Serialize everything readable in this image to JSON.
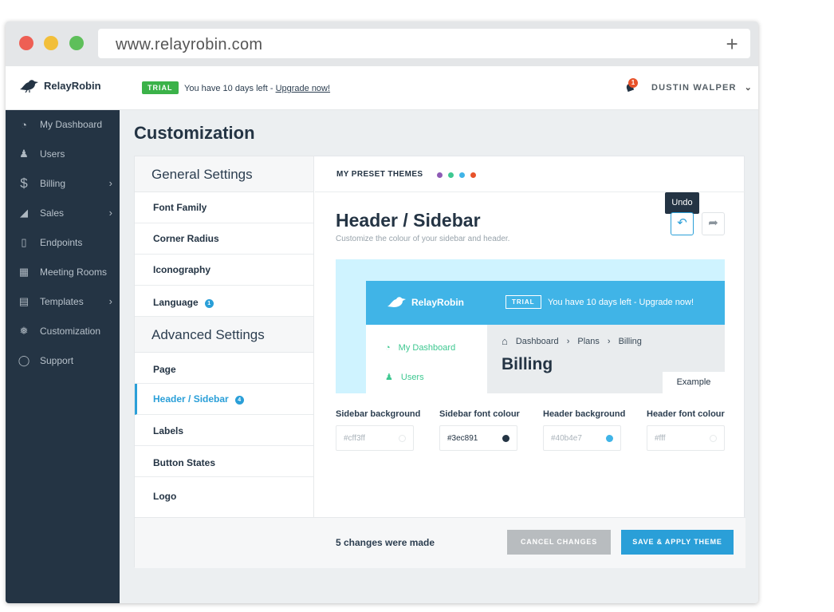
{
  "browser": {
    "url": "www.relayrobin.com"
  },
  "topbar": {
    "logo_text": "RelayRobin",
    "trial_badge": "TRIAL",
    "trial_message": "You have 10 days left - ",
    "upgrade_link": "Upgrade now!",
    "notification_count": "1",
    "user_name": "DUSTIN WALPER"
  },
  "sidebar": {
    "items": [
      {
        "label": "My Dashboard",
        "icon": "gauge-icon"
      },
      {
        "label": "Users",
        "icon": "users-icon"
      },
      {
        "label": "Billing",
        "icon": "dollar-icon",
        "has_submenu": true
      },
      {
        "label": "Sales",
        "icon": "chart-icon",
        "has_submenu": true
      },
      {
        "label": "Endpoints",
        "icon": "phone-icon"
      },
      {
        "label": "Meeting Rooms",
        "icon": "chat-icon"
      },
      {
        "label": "Templates",
        "icon": "template-icon",
        "has_submenu": true
      },
      {
        "label": "Customization",
        "icon": "drops-icon"
      },
      {
        "label": "Support",
        "icon": "lifebuoy-icon"
      }
    ]
  },
  "page": {
    "title": "Customization"
  },
  "left": {
    "general_heading": "General Settings",
    "general_items": [
      "Font Family",
      "Corner Radius",
      "Iconography",
      "Language"
    ],
    "language_count": "1",
    "advanced_heading": "Advanced Settings",
    "advanced_items": [
      "Page",
      "Header / Sidebar",
      "Labels",
      "Button States",
      "Logo"
    ],
    "header_sidebar_count": "4"
  },
  "presets": {
    "label": "MY PRESET THEMES",
    "colors": [
      "#8e5bb5",
      "#3ec891",
      "#40b4e7",
      "#e7522a"
    ]
  },
  "section": {
    "title": "Header / Sidebar",
    "subtitle": "Customize the colour of your sidebar and header.",
    "undo_tooltip": "Undo"
  },
  "preview": {
    "logo_text": "RelayRobin",
    "trial_badge": "TRIAL",
    "trial_message": "You have 10 days left - Upgrade now!",
    "nav_dashboard": "My Dashboard",
    "nav_users": "Users",
    "crumbs": [
      "Dashboard",
      "Plans",
      "Billing"
    ],
    "title": "Billing",
    "example_button": "Example"
  },
  "fields": [
    {
      "label": "Sidebar background",
      "value": "#cff3ff",
      "swatch": "#ffffff"
    },
    {
      "label": "Sidebar font colour",
      "value": "#3ec891",
      "swatch": "#243444"
    },
    {
      "label": "Header background",
      "value": "#40b4e7",
      "swatch": "#40b4e7"
    },
    {
      "label": "Header font colour",
      "value": "#fff",
      "swatch": "#ffffff"
    }
  ],
  "footer": {
    "changes": "5 changes were made",
    "cancel": "CANCEL CHANGES",
    "save": "SAVE & APPLY THEME"
  }
}
